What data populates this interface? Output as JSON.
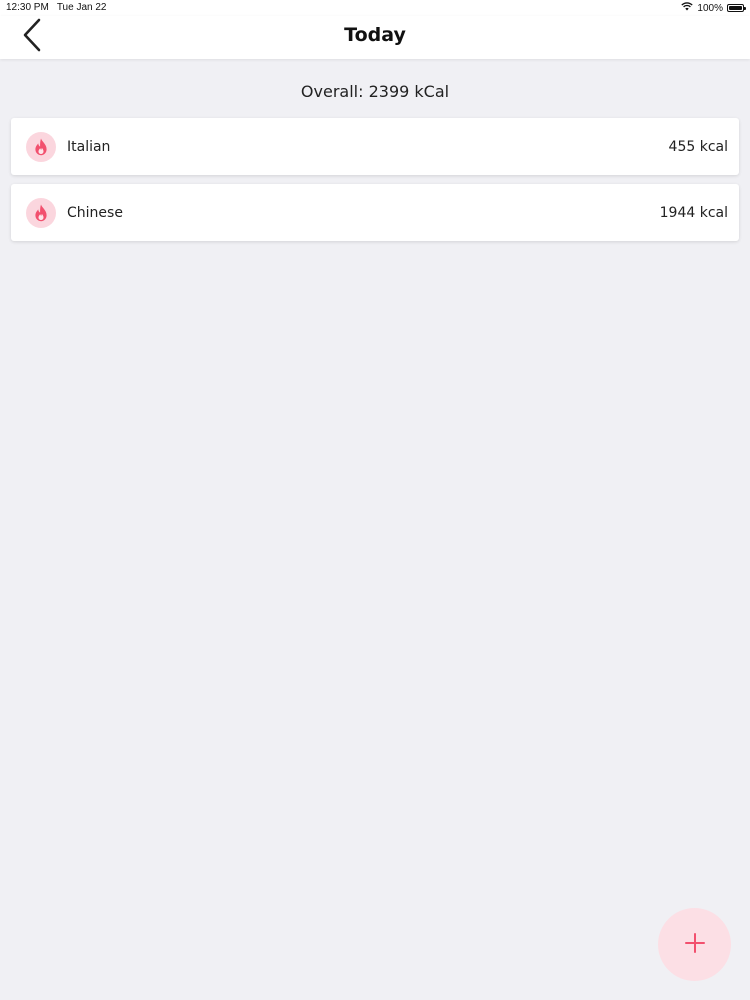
{
  "status_bar": {
    "time": "12:30 PM",
    "date": "Tue Jan 22",
    "battery_percent": "100%",
    "wifi_icon": "wifi-icon",
    "battery_icon": "battery-icon"
  },
  "nav": {
    "title": "Today",
    "back_icon": "chevron-left-icon"
  },
  "summary": {
    "overall": "Overall: 2399 kCal"
  },
  "meals": [
    {
      "name": "Italian",
      "kcal": "455 kcal",
      "icon": "flame-icon"
    },
    {
      "name": "Chinese",
      "kcal": "1944 kcal",
      "icon": "flame-icon"
    }
  ],
  "fab": {
    "icon": "plus-icon"
  },
  "colors": {
    "accent": "#f2506e",
    "accent_light": "#fbd6de",
    "fab_bg": "#fcdfe5",
    "background": "#f0f0f4",
    "card": "#ffffff"
  }
}
